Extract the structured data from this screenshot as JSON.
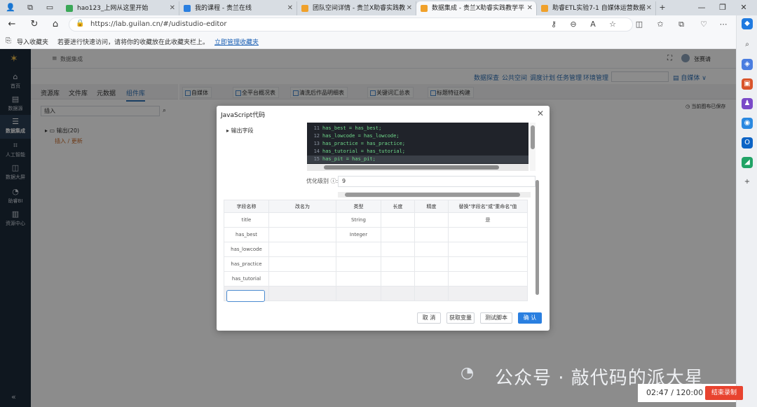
{
  "browser": {
    "tabs": [
      {
        "label": "hao123_上网从这里开始"
      },
      {
        "label": "我的课程 - 贵兰在线"
      },
      {
        "label": "团队空间详情 - 贵兰X助睿实践教"
      },
      {
        "label": "数据集成 - 贵兰X助睿实践教学平"
      },
      {
        "label": "助睿ETL实验7-1 自媒体运营数据"
      }
    ],
    "new_tab_glyph": "+",
    "url": "https://lab.guilan.cn/#/udistudio-editor",
    "fav_import": "导入收藏夹",
    "fav_hint": "若要进行快速访问，请将你的收藏放在此收藏夹栏上。",
    "fav_manage": "立即管理收藏夹"
  },
  "sidebar": {
    "items": [
      {
        "label": "首页",
        "icon": "home-icon"
      },
      {
        "label": "数据源",
        "icon": "database-icon"
      },
      {
        "label": "数据集成",
        "icon": "integration-icon"
      },
      {
        "label": "人工智能",
        "icon": "ai-icon"
      },
      {
        "label": "数据大屏",
        "icon": "screen-icon"
      },
      {
        "label": "助睿BI",
        "icon": "bi-icon"
      },
      {
        "label": "资源中心",
        "icon": "resource-icon"
      }
    ]
  },
  "header": {
    "breadcrumb": "数据集成",
    "user": "张赛请"
  },
  "menu": {
    "items": [
      "数据探查",
      "公共空间",
      "调度计划",
      "任务管理",
      "环境管理"
    ],
    "workspace": "自媒体"
  },
  "left_panel": {
    "tabs": [
      "资源库",
      "文件库",
      "元数据",
      "组件库"
    ],
    "search": "插入",
    "tree_root": "输出(20)",
    "tree_leaf": "插入 / 更新"
  },
  "editor_tabs": [
    "自媒体",
    "全平台概况表",
    "清洗后作品明细表",
    "关键词汇总表",
    "标题特征构建"
  ],
  "save_status": "当前图布已保存",
  "dialog": {
    "title": "JavaScript代码",
    "tree_item": "输出字段",
    "code_lines": [
      {
        "n": "11",
        "t": "has_best = has_best;"
      },
      {
        "n": "12",
        "t": "has_lowcode = has_lowcode;"
      },
      {
        "n": "13",
        "t": "has_practice = has_practice;"
      },
      {
        "n": "14",
        "t": "has_tutorial = has_tutorial;"
      },
      {
        "n": "15",
        "t": "has_pit = has_pit;"
      }
    ],
    "opt_label": "优化级别",
    "opt_value": "9",
    "columns": [
      "字段名称",
      "改名为",
      "类型",
      "长度",
      "精度",
      "替换\"字段名\"或\"重命名\"值"
    ],
    "rows": [
      [
        "title",
        "",
        "String",
        "",
        "",
        "是"
      ],
      [
        "has_best",
        "",
        "Integer",
        "",
        "",
        ""
      ],
      [
        "has_lowcode",
        "",
        "",
        "",
        "",
        ""
      ],
      [
        "has_practice",
        "",
        "",
        "",
        "",
        ""
      ],
      [
        "has_tutorial",
        "",
        "",
        "",
        "",
        ""
      ]
    ],
    "buttons": {
      "cancel": "取 消",
      "get_vars": "获取变量",
      "test": "测试脚本",
      "ok": "确 认"
    }
  },
  "overlay": {
    "watermark": "公众号 · 敲代码的派大星",
    "timer": "02:47 / 120:00",
    "end_record": "结束录制"
  },
  "colors": {
    "accent": "#2a7fe0",
    "sidebar_bg": "#1d2b3a",
    "code_green": "#6fd88a",
    "record_red": "#e8432f"
  }
}
